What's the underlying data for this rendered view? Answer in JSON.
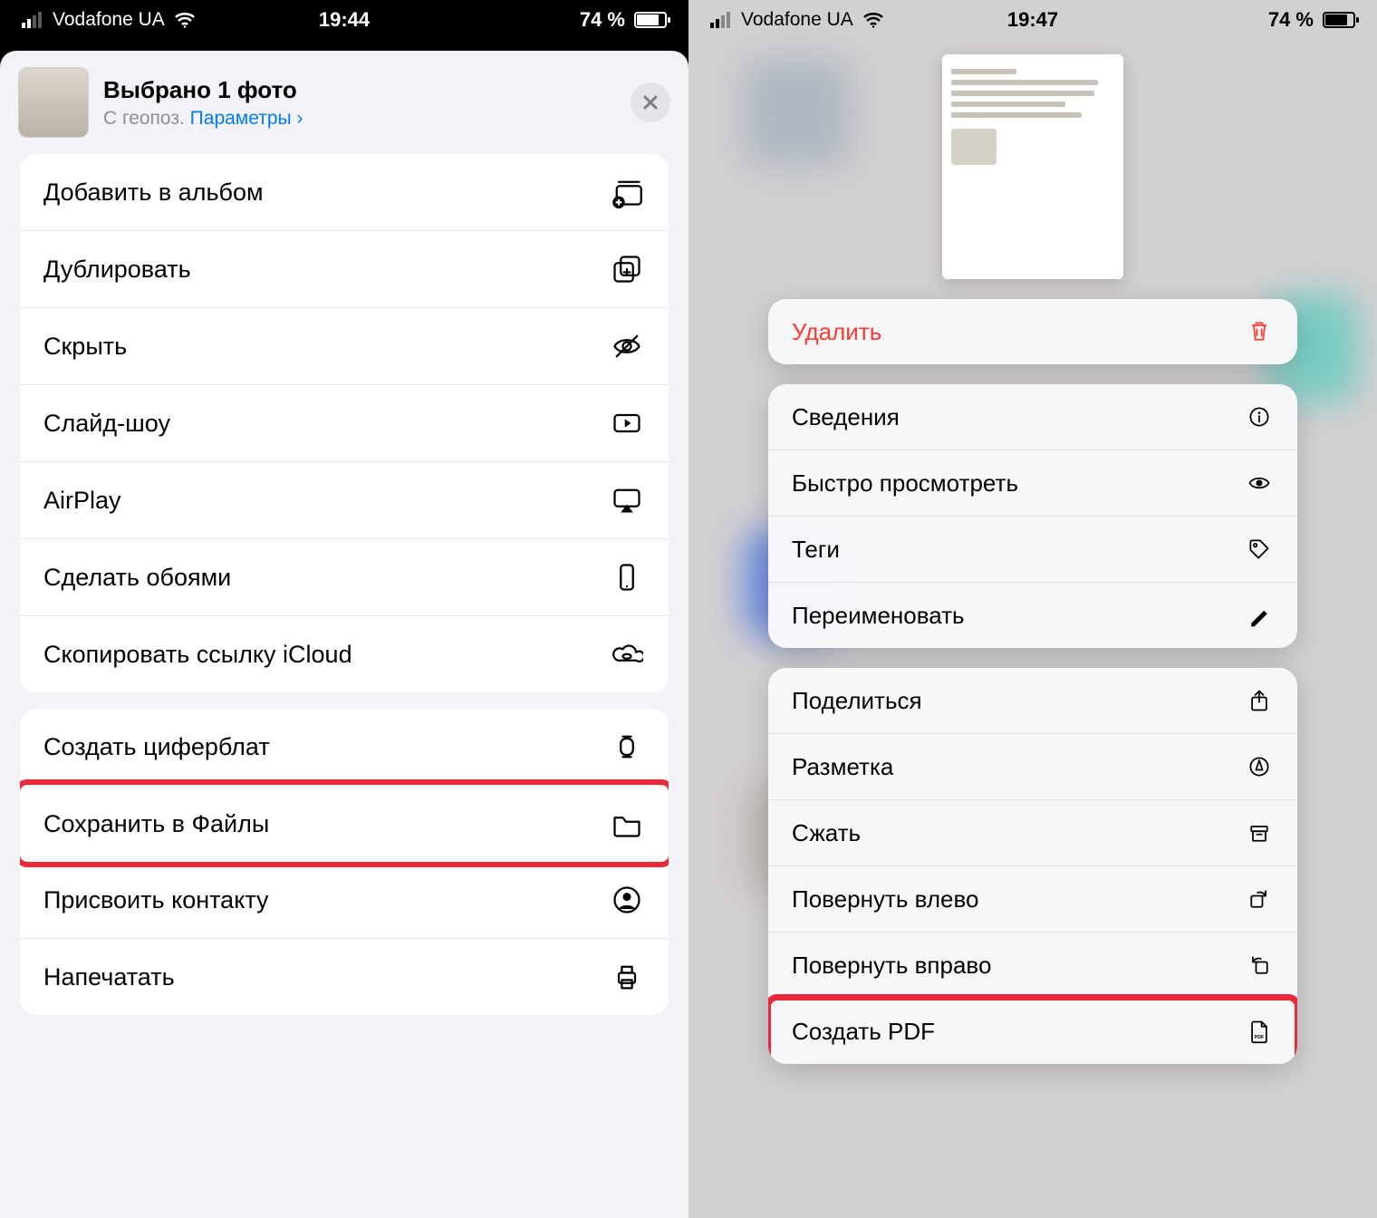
{
  "left": {
    "status": {
      "carrier": "Vodafone UA",
      "time": "19:44",
      "battery": "74 %"
    },
    "header": {
      "title": "Выбрано 1 фото",
      "subtitle_prefix": "С геопоз.  ",
      "options_link": "Параметры ›"
    },
    "group1": [
      {
        "label": "Добавить в альбом",
        "icon": "album-add"
      },
      {
        "label": "Дублировать",
        "icon": "duplicate"
      },
      {
        "label": "Скрыть",
        "icon": "eye-slash"
      },
      {
        "label": "Слайд-шоу",
        "icon": "play-rect"
      },
      {
        "label": "AirPlay",
        "icon": "airplay"
      },
      {
        "label": "Сделать обоями",
        "icon": "phone"
      },
      {
        "label": "Скопировать ссылку iCloud",
        "icon": "cloud-link"
      }
    ],
    "group2": [
      {
        "label": "Создать циферблат",
        "icon": "watch"
      },
      {
        "label": "Сохранить в Файлы",
        "icon": "folder",
        "highlight": true
      },
      {
        "label": "Присвоить контакту",
        "icon": "contact"
      },
      {
        "label": "Напечатать",
        "icon": "print"
      }
    ]
  },
  "right": {
    "status": {
      "carrier": "Vodafone UA",
      "time": "19:47",
      "battery": "74 %"
    },
    "group1": [
      {
        "label": "Удалить",
        "icon": "trash",
        "destructive": true
      }
    ],
    "group2": [
      {
        "label": "Сведения",
        "icon": "info"
      },
      {
        "label": "Быстро просмотреть",
        "icon": "eye"
      },
      {
        "label": "Теги",
        "icon": "tag"
      },
      {
        "label": "Переименовать",
        "icon": "pencil"
      }
    ],
    "group3": [
      {
        "label": "Поделиться",
        "icon": "share"
      },
      {
        "label": "Разметка",
        "icon": "markup"
      },
      {
        "label": "Сжать",
        "icon": "archive"
      },
      {
        "label": "Повернуть влево",
        "icon": "rotate-left"
      },
      {
        "label": "Повернуть вправо",
        "icon": "rotate-right"
      },
      {
        "label": "Создать PDF",
        "icon": "pdf",
        "highlight": true
      }
    ]
  }
}
